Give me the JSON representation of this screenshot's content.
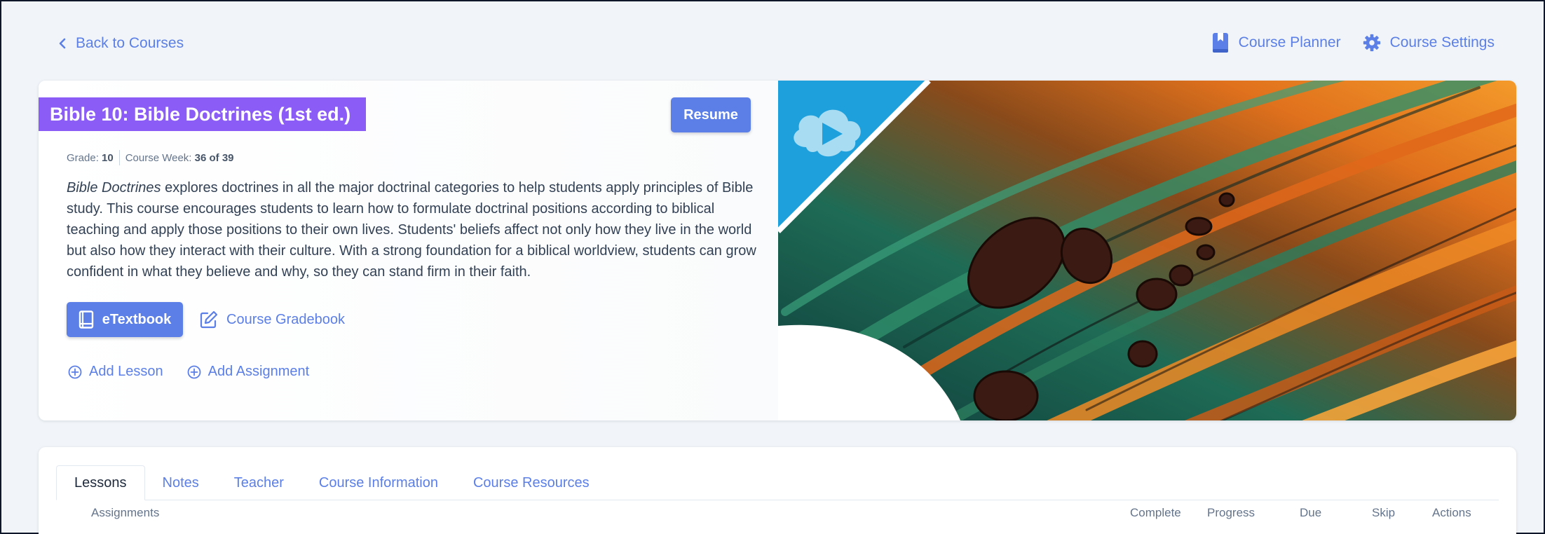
{
  "nav": {
    "back_label": "Back to Courses",
    "planner_label": "Course Planner",
    "settings_label": "Course Settings"
  },
  "course": {
    "title": "Bible 10: Bible Doctrines (1st ed.)",
    "resume_label": "Resume",
    "grade_label": "Grade:",
    "grade_value": "10",
    "week_label": "Course Week:",
    "week_value": "36 of 39",
    "description_em": "Bible Doctrines",
    "description_rest": " explores doctrines in all the major doctrinal categories to help students apply principles of Bible study. This course encourages students to learn how to formulate doctrinal positions according to biblical teaching and apply those positions to their own lives. Students' beliefs affect not only how they live in the world but also how they interact with their culture. With a strong foundation for a biblical worldview, students can grow confident in what they believe and why, so they can stand firm in their faith.",
    "etextbook_label": "eTextbook",
    "gradebook_label": "Course Gradebook",
    "add_lesson_label": "Add Lesson",
    "add_assignment_label": "Add Assignment"
  },
  "tabs": [
    {
      "label": "Lessons",
      "active": true
    },
    {
      "label": "Notes",
      "active": false
    },
    {
      "label": "Teacher",
      "active": false
    },
    {
      "label": "Course Information",
      "active": false
    },
    {
      "label": "Course Resources",
      "active": false
    }
  ],
  "table": {
    "columns": [
      "Assignments",
      "Complete",
      "Progress",
      "Due",
      "Skip",
      "Actions"
    ]
  },
  "colors": {
    "accent": "#5b7fe6",
    "title_bg": "#8b5cf6",
    "page_bg": "#f1f5f9",
    "video_badge": "#1ea0dc"
  },
  "icons": {
    "back": "chevron-left-icon",
    "planner": "book-bookmark-icon",
    "settings": "gear-icon",
    "etextbook": "book-icon",
    "gradebook": "edit-icon",
    "add": "plus-circle-icon",
    "video": "play-cloud-icon"
  }
}
